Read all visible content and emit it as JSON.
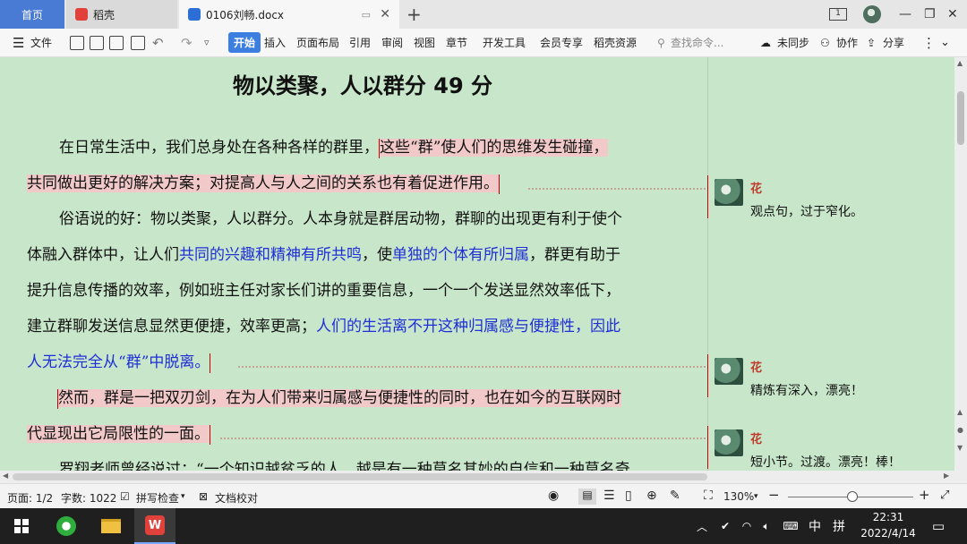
{
  "tabs": {
    "home": "首页",
    "daoke": "稻壳",
    "doc": "0106刘畅.docx"
  },
  "toolbar": {
    "file": "文件",
    "items": [
      "开始",
      "插入",
      "页面布局",
      "引用",
      "审阅",
      "视图",
      "章节",
      "开发工具",
      "会员专享",
      "稻壳资源"
    ],
    "search_placeholder": "查找命令...",
    "sync": "未同步",
    "collab": "协作",
    "share": "分享"
  },
  "document": {
    "title": "物以类聚，人以群分 49 分",
    "p1": {
      "l1_plain": "在日常生活中，我们总身处在各种各样的群里，",
      "l1_hl": "这些“群”使人们的思维发生碰撞，",
      "l2_hl": "共同做出更好的解决方案；对提高人与人之间的关系也有着促进作用。"
    },
    "p2": {
      "l1": "俗语说的好：物以类聚，人以群分。人本身就是群居动物，群聊的出现更有利于使个",
      "l2_a": "体融入群体中，让人们",
      "l2_b": "共同的兴趣和精神有所共鸣",
      "l2_c": "，使",
      "l2_d": "单独的个体有所归属",
      "l2_e": "，群更有助于",
      "l3": "提升信息传播的效率，例如班主任对家长们讲的重要信息，一个一个发送显然效率低下，",
      "l4_a": "建立群聊发送信息显然更便捷，效率更高；",
      "l4_b": "人们的生活离不开这种归属感与便捷性，因此",
      "l5": "人无法完全从“群”中脱离。"
    },
    "p3": {
      "l1": "然而，群是一把双刃剑，在为人们带来归属感与便捷性的同时，也在如今的互联网时",
      "l2": "代显现出它局限性的一面。"
    },
    "p4": {
      "l1": "罗翔老师曾经说过：“一个知识越贫乏的人，越是有一种莫名其妙的自信和一种莫名奇"
    }
  },
  "comments": [
    {
      "author": "花",
      "text": "观点句，过于窄化。"
    },
    {
      "author": "花",
      "text": "精炼有深入，漂亮！"
    },
    {
      "author": "花",
      "text": "短小节。过渡。漂亮！棒！"
    }
  ],
  "status": {
    "page": "页面: 1/2",
    "words": "字数: 1022",
    "spell": "拼写检查",
    "proof": "文档校对",
    "zoom": "130%"
  },
  "taskbar": {
    "time": "22:31",
    "date": "2022/4/14",
    "ime": "中",
    "ime2": "拼"
  },
  "colors": {
    "background": "#c8e6c9",
    "highlight": "#f1c9c9",
    "link_blue": "#1f2fd8",
    "accent": "#3c7fe0",
    "comment_author": "#c0392b"
  }
}
